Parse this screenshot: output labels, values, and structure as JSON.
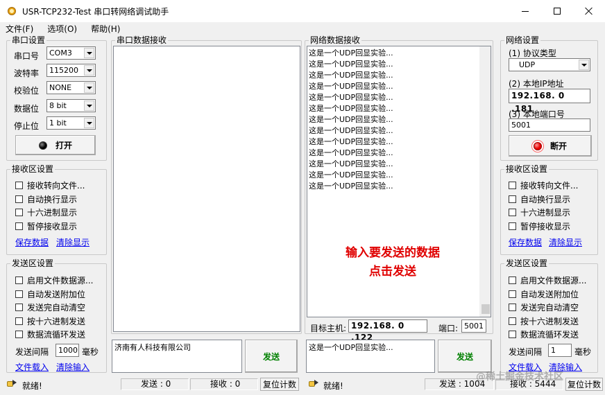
{
  "window": {
    "title": "USR-TCP232-Test 串口转网络调试助手"
  },
  "menu": [
    "文件(F)",
    "选项(O)",
    "帮助(H)"
  ],
  "serial_settings": {
    "title": "串口设置",
    "rows": [
      {
        "label": "串口号",
        "value": "COM3"
      },
      {
        "label": "波特率",
        "value": "115200"
      },
      {
        "label": "校验位",
        "value": "NONE"
      },
      {
        "label": "数据位",
        "value": "8 bit"
      },
      {
        "label": "停止位",
        "value": "1 bit"
      }
    ],
    "open_button": "打开"
  },
  "left_receive": {
    "title": "接收区设置",
    "checks": [
      "接收转向文件...",
      "自动换行显示",
      "十六进制显示",
      "暂停接收显示"
    ],
    "save_link": "保存数据",
    "clear_link": "清除显示"
  },
  "left_send": {
    "title": "发送区设置",
    "checks": [
      "启用文件数据源...",
      "自动发送附加位",
      "发送完自动清空",
      "按十六进制发送",
      "数据流循环发送"
    ],
    "interval_label": "发送间隔",
    "interval_value": "1000",
    "interval_unit": "毫秒",
    "load_link": "文件载入",
    "clear_link": "清除输入"
  },
  "serial_receive": {
    "title": "串口数据接收"
  },
  "serial_send": {
    "text": "济南有人科技有限公司",
    "send_button": "发送"
  },
  "network_receive": {
    "title": "网络数据接收",
    "lines": [
      "这是一个UDP回显实验...",
      "这是一个UDP回显实验...",
      "这是一个UDP回显实验...",
      "这是一个UDP回显实验...",
      "这是一个UDP回显实验...",
      "这是一个UDP回显实验...",
      "这是一个UDP回显实验...",
      "这是一个UDP回显实验...",
      "这是一个UDP回显实验...",
      "这是一个UDP回显实验...",
      "这是一个UDP回显实验...",
      "这是一个UDP回显实验...",
      "这是一个UDP回显实验..."
    ],
    "hint_line1": "输入要发送的数据",
    "hint_line2": "点击发送"
  },
  "target": {
    "host_label": "目标主机:",
    "host_value": "192.168. 0 .122",
    "port_label": "端口:",
    "port_value": "5001"
  },
  "network_send": {
    "text": "这是一个UDP回显实验...",
    "send_button": "发送"
  },
  "network_settings": {
    "title": "网络设置",
    "protocol_label": "(1) 协议类型",
    "protocol_value": "UDP",
    "ip_label": "(2) 本地IP地址",
    "ip_value": "192.168. 0 .181",
    "port_label": "(3) 本地端口号",
    "port_value": "5001",
    "connect_button": "断开"
  },
  "right_receive": {
    "title": "接收区设置",
    "checks": [
      "接收转向文件...",
      "自动换行显示",
      "十六进制显示",
      "暂停接收显示"
    ],
    "save_link": "保存数据",
    "clear_link": "清除显示"
  },
  "right_send": {
    "title": "发送区设置",
    "checks": [
      "启用文件数据源...",
      "自动发送附加位",
      "发送完自动清空",
      "按十六进制发送",
      "数据流循环发送"
    ],
    "interval_label": "发送间隔",
    "interval_value": "1",
    "interval_unit": "毫秒",
    "load_link": "文件载入",
    "clear_link": "清除输入"
  },
  "status_left": {
    "ready": "就绪!",
    "sent": "发送 : 0",
    "received": "接收 : 0",
    "reset": "复位计数"
  },
  "status_right": {
    "ready": "就绪!",
    "sent": "发送 : 1004",
    "received": "接收 : 5444",
    "reset": "复位计数"
  },
  "watermark": "@稀土掘金技术社区"
}
